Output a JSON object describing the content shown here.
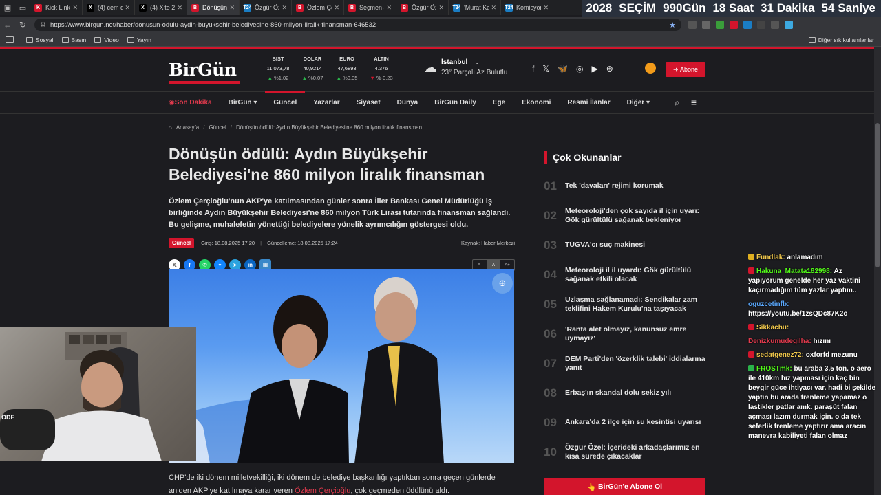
{
  "browser": {
    "tabs": [
      {
        "title": "Kick Link ",
        "fav": "K",
        "color": "#d3152c",
        "active": false
      },
      {
        "title": "(4) cem d",
        "fav": "X",
        "color": "#000000",
        "active": false
      },
      {
        "title": "(4) X'te 2",
        "fav": "X",
        "color": "#000000",
        "active": false
      },
      {
        "title": "Dönüşün ",
        "fav": "B",
        "color": "#d3152c",
        "active": true
      },
      {
        "title": "Özgür Öz",
        "fav": "T24",
        "color": "#1a7dc4",
        "active": false
      },
      {
        "title": "Özlem Çe",
        "fav": "B",
        "color": "#d3152c",
        "active": false
      },
      {
        "title": "Seçmen a",
        "fav": "B",
        "color": "#d3152c",
        "active": false
      },
      {
        "title": "Özgür Öz",
        "fav": "B",
        "color": "#d3152c",
        "active": false
      },
      {
        "title": "'Murat Ka",
        "fav": "T24",
        "color": "#1a7dc4",
        "active": false
      },
      {
        "title": "Komisyon",
        "fav": "T24",
        "color": "#1a7dc4",
        "active": false
      }
    ],
    "url": "https://www.birgun.net/haber/donusun-odulu-aydin-buyuksehir-belediyesine-860-milyon-liralik-finansman-646532",
    "bookmarks": [
      "Sosyal",
      "Basın",
      "Video",
      "Yayın"
    ],
    "bookmarks_other": "Diğer sık kullanılanlar"
  },
  "countdown": {
    "year": "2028",
    "label": "SEÇİM",
    "days": "990",
    "days_label": "Gün",
    "hours": "18",
    "hours_label": "Saat",
    "minutes": "31",
    "minutes_label": "Dakika",
    "seconds": "54",
    "seconds_label": "Saniye"
  },
  "site": {
    "logo": "BirGün",
    "markets": [
      {
        "label": "BIST",
        "value": "11.073,78",
        "change": "%1,02",
        "dir": "up"
      },
      {
        "label": "DOLAR",
        "value": "40,9214",
        "change": "%0,07",
        "dir": "up"
      },
      {
        "label": "EURO",
        "value": "47,6893",
        "change": "%0,05",
        "dir": "up"
      },
      {
        "label": "ALTIN",
        "value": "4.376",
        "change": "%-0,23",
        "dir": "down"
      }
    ],
    "weather": {
      "city": "İstanbul",
      "condition": "23° Parçalı Az Bulutlu"
    },
    "abone": "Abone",
    "nav": [
      {
        "label": "Son Dakika",
        "breaking": true
      },
      {
        "label": "BirGün ▾"
      },
      {
        "label": "Güncel",
        "active": true
      },
      {
        "label": "Yazarlar"
      },
      {
        "label": "Siyaset"
      },
      {
        "label": "Dünya"
      },
      {
        "label": "BirGün Daily"
      },
      {
        "label": "Ege"
      },
      {
        "label": "Ekonomi"
      },
      {
        "label": "Resmi İlanlar"
      },
      {
        "label": "Diğer ▾"
      }
    ]
  },
  "breadcrumb": {
    "home": "Anasayfa",
    "section": "Güncel",
    "current": "Dönüşün ödülü: Aydın Büyükşehir Belediyesi'ne 860 milyon liralık finansman"
  },
  "article": {
    "title": "Dönüşün ödülü: Aydın Büyükşehir Belediyesi'ne 860 milyon liralık finansman",
    "summary": "Özlem Çerçioğlu'nun AKP'ye katılmasından günler sonra İller Bankası Genel Müdürlüğü iş birliğinde Aydın Büyükşehir Belediyesi'ne 860 milyon Türk Lirası tutarında finansman sağlandı. Bu gelişme, muhalefetin yönettiği belediyelere yönelik ayrımcılığın göstergesi oldu.",
    "category": "Güncel",
    "published": "Giriş: 18.08.2025 17:20",
    "updated": "Güncelleme: 18.08.2025 17:24",
    "source": "Kaynak: Haber Merkezi",
    "font_controls": [
      "A-",
      "A",
      "A+"
    ],
    "body_start": "CHP'de iki dönem milletvekilliği, iki dönem de belediye başkanlığı yaptıktan sonra geçen günlerde",
    "body_line2_pre": "aniden AKP'ye katılmaya karar veren ",
    "body_link": "Özlem Çerçioğlu",
    "body_line2_post": ", çok geçmeden ödülünü aldı."
  },
  "most_read": {
    "title": "Çok Okunanlar",
    "items": [
      {
        "num": "01",
        "text": "Tek 'davaları' rejimi korumak"
      },
      {
        "num": "02",
        "text": "Meteoroloji'den çok sayıda il için uyarı: Gök gürültülü sağanak bekleniyor"
      },
      {
        "num": "03",
        "text": "TÜGVA'cı suç makinesi"
      },
      {
        "num": "04",
        "text": "Meteoroloji il il uyardı: Gök gürültülü sağanak etkili olacak"
      },
      {
        "num": "05",
        "text": "Uzlaşma sağlanamadı: Sendikalar zam teklifini Hakem Kurulu'na taşıyacak"
      },
      {
        "num": "06",
        "text": "'Ranta alet olmayız, kanunsuz emre uymayız'"
      },
      {
        "num": "07",
        "text": "DEM Parti'den 'özerklik talebi' iddialarına yanıt"
      },
      {
        "num": "08",
        "text": "Erbaş'ın skandal dolu sekiz yılı"
      },
      {
        "num": "09",
        "text": "Ankara'da 2 ilçe için su kesintisi uyarısı"
      },
      {
        "num": "10",
        "text": "Özgür Özel: İçerideki arkadaşlarımız en kısa sürede çıkacaklar"
      }
    ],
    "subscribe": "BirGün'e Abone Ol"
  },
  "chat": [
    {
      "user": "Fundlak:",
      "color": "#f2c94c",
      "text": "anlamadım",
      "badge": "#e0b020"
    },
    {
      "user": "Hakuna_Matata182998:",
      "color": "#53fc18",
      "text": "Az yapıyorum genelde her yaz vaktini kaçırmadığım tüm yazlar yaptım..",
      "badge": "#d3152c"
    },
    {
      "user": "oguzcetinfb:",
      "color": "#5aa9ff",
      "text": "https://youtu.be/1zsQDc87K2o",
      "badge": ""
    },
    {
      "user": "Sikkachu:",
      "color": "#f2c94c",
      "text": "",
      "badge": "#d3152c"
    },
    {
      "user": "Denizkumudegilha:",
      "color": "#e23a4d",
      "text": "hızını",
      "badge": ""
    },
    {
      "user": "sedatgenez72:",
      "color": "#f2c94c",
      "text": "oxforfd mezunu",
      "badge": "#d3152c"
    },
    {
      "user": "FROSTmk:",
      "color": "#53fc18",
      "text": "bu araba 3.5 ton. o aero ile 410km hız yapması için kaç bin beygir güce ihtiyacı var. hadi bi şekilde yaptın bu arada frenleme yapamaz o lastikler patlar amk. paraşüt falan açması lazım durmak için. o da tek seferlik frenleme yaptırır ama aracın manevra kabiliyeti falan olmaz",
      "badge": "#2ab34a"
    }
  ]
}
